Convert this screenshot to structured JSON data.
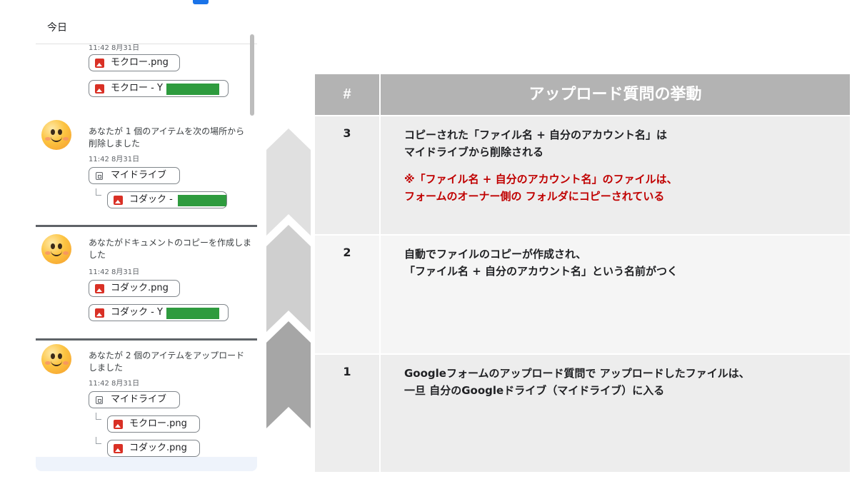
{
  "panel": {
    "header": "今日",
    "activities": [
      {
        "time": "11:42 8月31日",
        "files": [
          "モクロー.png",
          "モクロー - Y"
        ]
      },
      {
        "text": "あなたが 1 個のアイテムを次の場所から削除しました",
        "time": "11:42 8月31日",
        "folder": "マイドライブ",
        "files": [
          "コダック - "
        ]
      },
      {
        "text": "あなたがドキュメントのコピーを作成しました",
        "time": "11:42 8月31日",
        "files": [
          "コダック.png",
          "コダック - Y"
        ]
      },
      {
        "text": "あなたが 2 個のアイテムをアップロードしました",
        "time": "11:42 8月31日",
        "folder": "マイドライブ",
        "files": [
          "モクロー.png",
          "コダック.png"
        ]
      }
    ]
  },
  "table": {
    "header_num": "#",
    "header_title": "アップロード質問の挙動",
    "rows": [
      {
        "num": "3",
        "line1": "コピーされた「ファイル名 + 自分のアカウント名」は",
        "line2": "マイドライブから削除される",
        "note1": "※「ファイル名 + 自分のアカウント名」のファイルは、",
        "note2": "フォームのオーナー側の フォルダにコピーされている"
      },
      {
        "num": "2",
        "line1": "自動でファイルのコピーが作成され、",
        "line2": "「ファイル名 + 自分のアカウント名」という名前がつく"
      },
      {
        "num": "1",
        "line1": "Googleフォームのアップロード質問で アップロードしたファイルは、",
        "line2": "一旦 自分のGoogleドライブ（マイドライブ）に入る"
      }
    ]
  },
  "colors": {
    "header_bg": "#b3b3b3",
    "row_bg": "#ededed",
    "note_red": "#c00000",
    "file_icon_red": "#d93025",
    "redaction_green": "#2e9b3e",
    "arrow_gray": "#bcbcbc"
  }
}
